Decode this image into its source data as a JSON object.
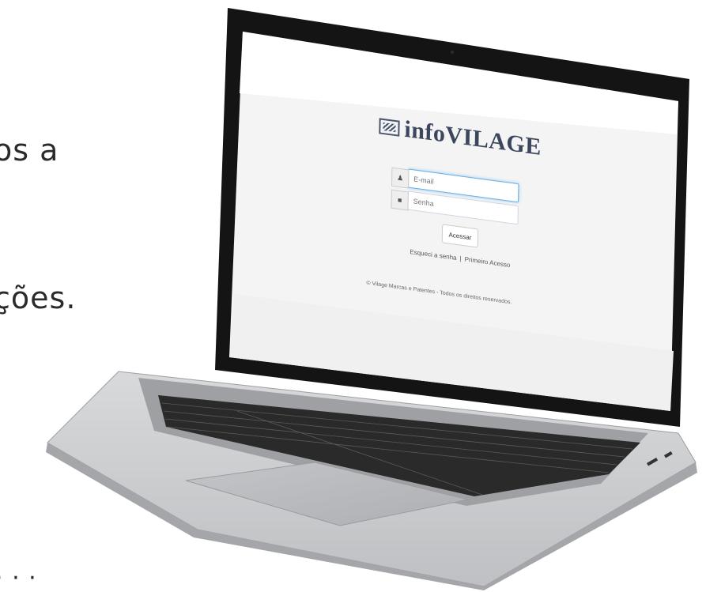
{
  "background_text": {
    "line1": "os a",
    "line2": "ções.",
    "line3": "·  ·  ·"
  },
  "screen": {
    "logo_text": "infoVILAGE",
    "email_placeholder": "E-mail",
    "senha_placeholder": "Senha",
    "submit_label": "Acessar",
    "forgot_label": "Esqueci a senha",
    "separator": "|",
    "first_access_label": "Primeiro Acesso",
    "footer_text": "© Vilage Marcas e Patentes - Todos os direitos reservados."
  },
  "colors": {
    "laptop_body": "#c9cacc",
    "bezel": "#151515",
    "keyboard_keys": "#1a1a1a",
    "logo": "#3c475e",
    "focus_border": "#66afe9"
  }
}
